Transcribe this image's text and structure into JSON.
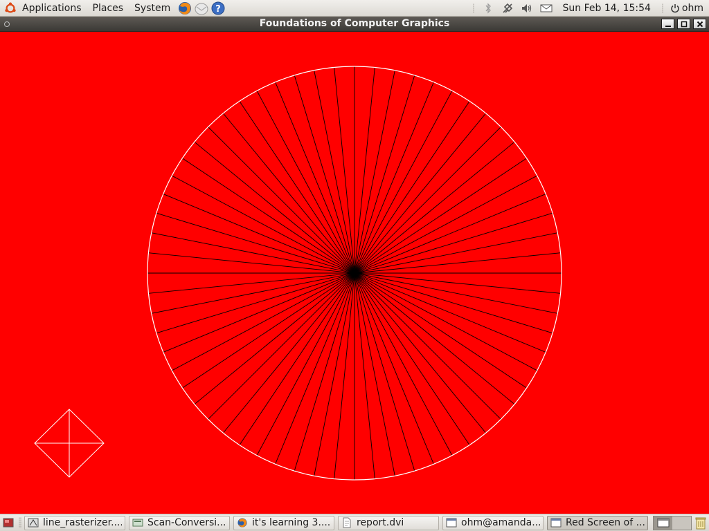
{
  "top_panel": {
    "menus": [
      "Applications",
      "Places",
      "System"
    ],
    "launchers": [
      "firefox-icon",
      "mail-icon",
      "help-icon"
    ],
    "tray_icons": [
      "bluetooth-icon",
      "network-icon",
      "volume-icon",
      "mail-indicator-icon"
    ],
    "clock": "Sun Feb 14, 15:54",
    "user": "ohm"
  },
  "window": {
    "title": "Foundations of Computer Graphics"
  },
  "canvas": {
    "background": "#ff0000",
    "circle_stroke": "#ffffff",
    "spoke_color": "#000000",
    "spoke_count": 64
  },
  "taskbar": {
    "tasks": [
      {
        "label": "line_rasterizer....",
        "icon": "gimp-icon"
      },
      {
        "label": "Scan-Conversi...",
        "icon": "image-viewer-icon"
      },
      {
        "label": "it's learning 3....",
        "icon": "firefox-icon"
      },
      {
        "label": "report.dvi",
        "icon": "document-icon"
      },
      {
        "label": "ohm@amanda...",
        "icon": "terminal-icon"
      },
      {
        "label": "Red Screen of ...",
        "icon": "window-icon"
      }
    ]
  }
}
